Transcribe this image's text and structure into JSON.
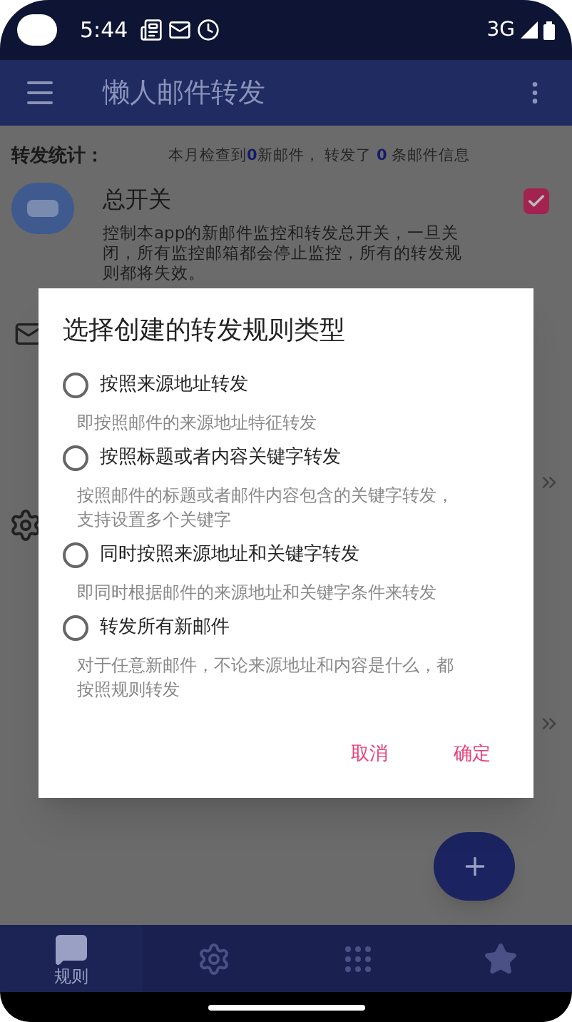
{
  "status_bar": {
    "time": "5:44",
    "network": "3G"
  },
  "app_bar": {
    "title": "懒人邮件转发"
  },
  "stats": {
    "label": "转发统计：",
    "summary": "本月检查到**0**新邮件， 转发了 **0** 条邮件信息"
  },
  "master_switch": {
    "title": "总开关",
    "description": "控制本app的新邮件监控和转发总开关，一旦关闭，所有监控邮箱都会停止监控，所有的转发规则都将失效。",
    "checked": true
  },
  "dialog": {
    "title": "选择创建的转发规则类型",
    "options": [
      {
        "label": "按照来源地址转发",
        "description": "即按照邮件的来源地址特征转发",
        "selected": false
      },
      {
        "label": "按照标题或者内容关键字转发",
        "description": "按照邮件的标题或者邮件内容包含的关键字转发，支持设置多个关键字",
        "selected": false
      },
      {
        "label": "同时按照来源地址和关键字转发",
        "description": "即同时根据邮件的来源地址和关键字条件来转发",
        "selected": false
      },
      {
        "label": "转发所有新邮件",
        "description": "对于任意新邮件，不论来源地址和内容是什么，都按照规则转发",
        "selected": false
      }
    ],
    "buttons": [
      "取消",
      "确定"
    ]
  },
  "bottom_nav": [
    {
      "kind": "rules",
      "label": "规则",
      "selected": true
    },
    {
      "kind": "settings",
      "selected": false
    },
    {
      "kind": "grid",
      "selected": false
    },
    {
      "kind": "star",
      "selected": false
    }
  ]
}
